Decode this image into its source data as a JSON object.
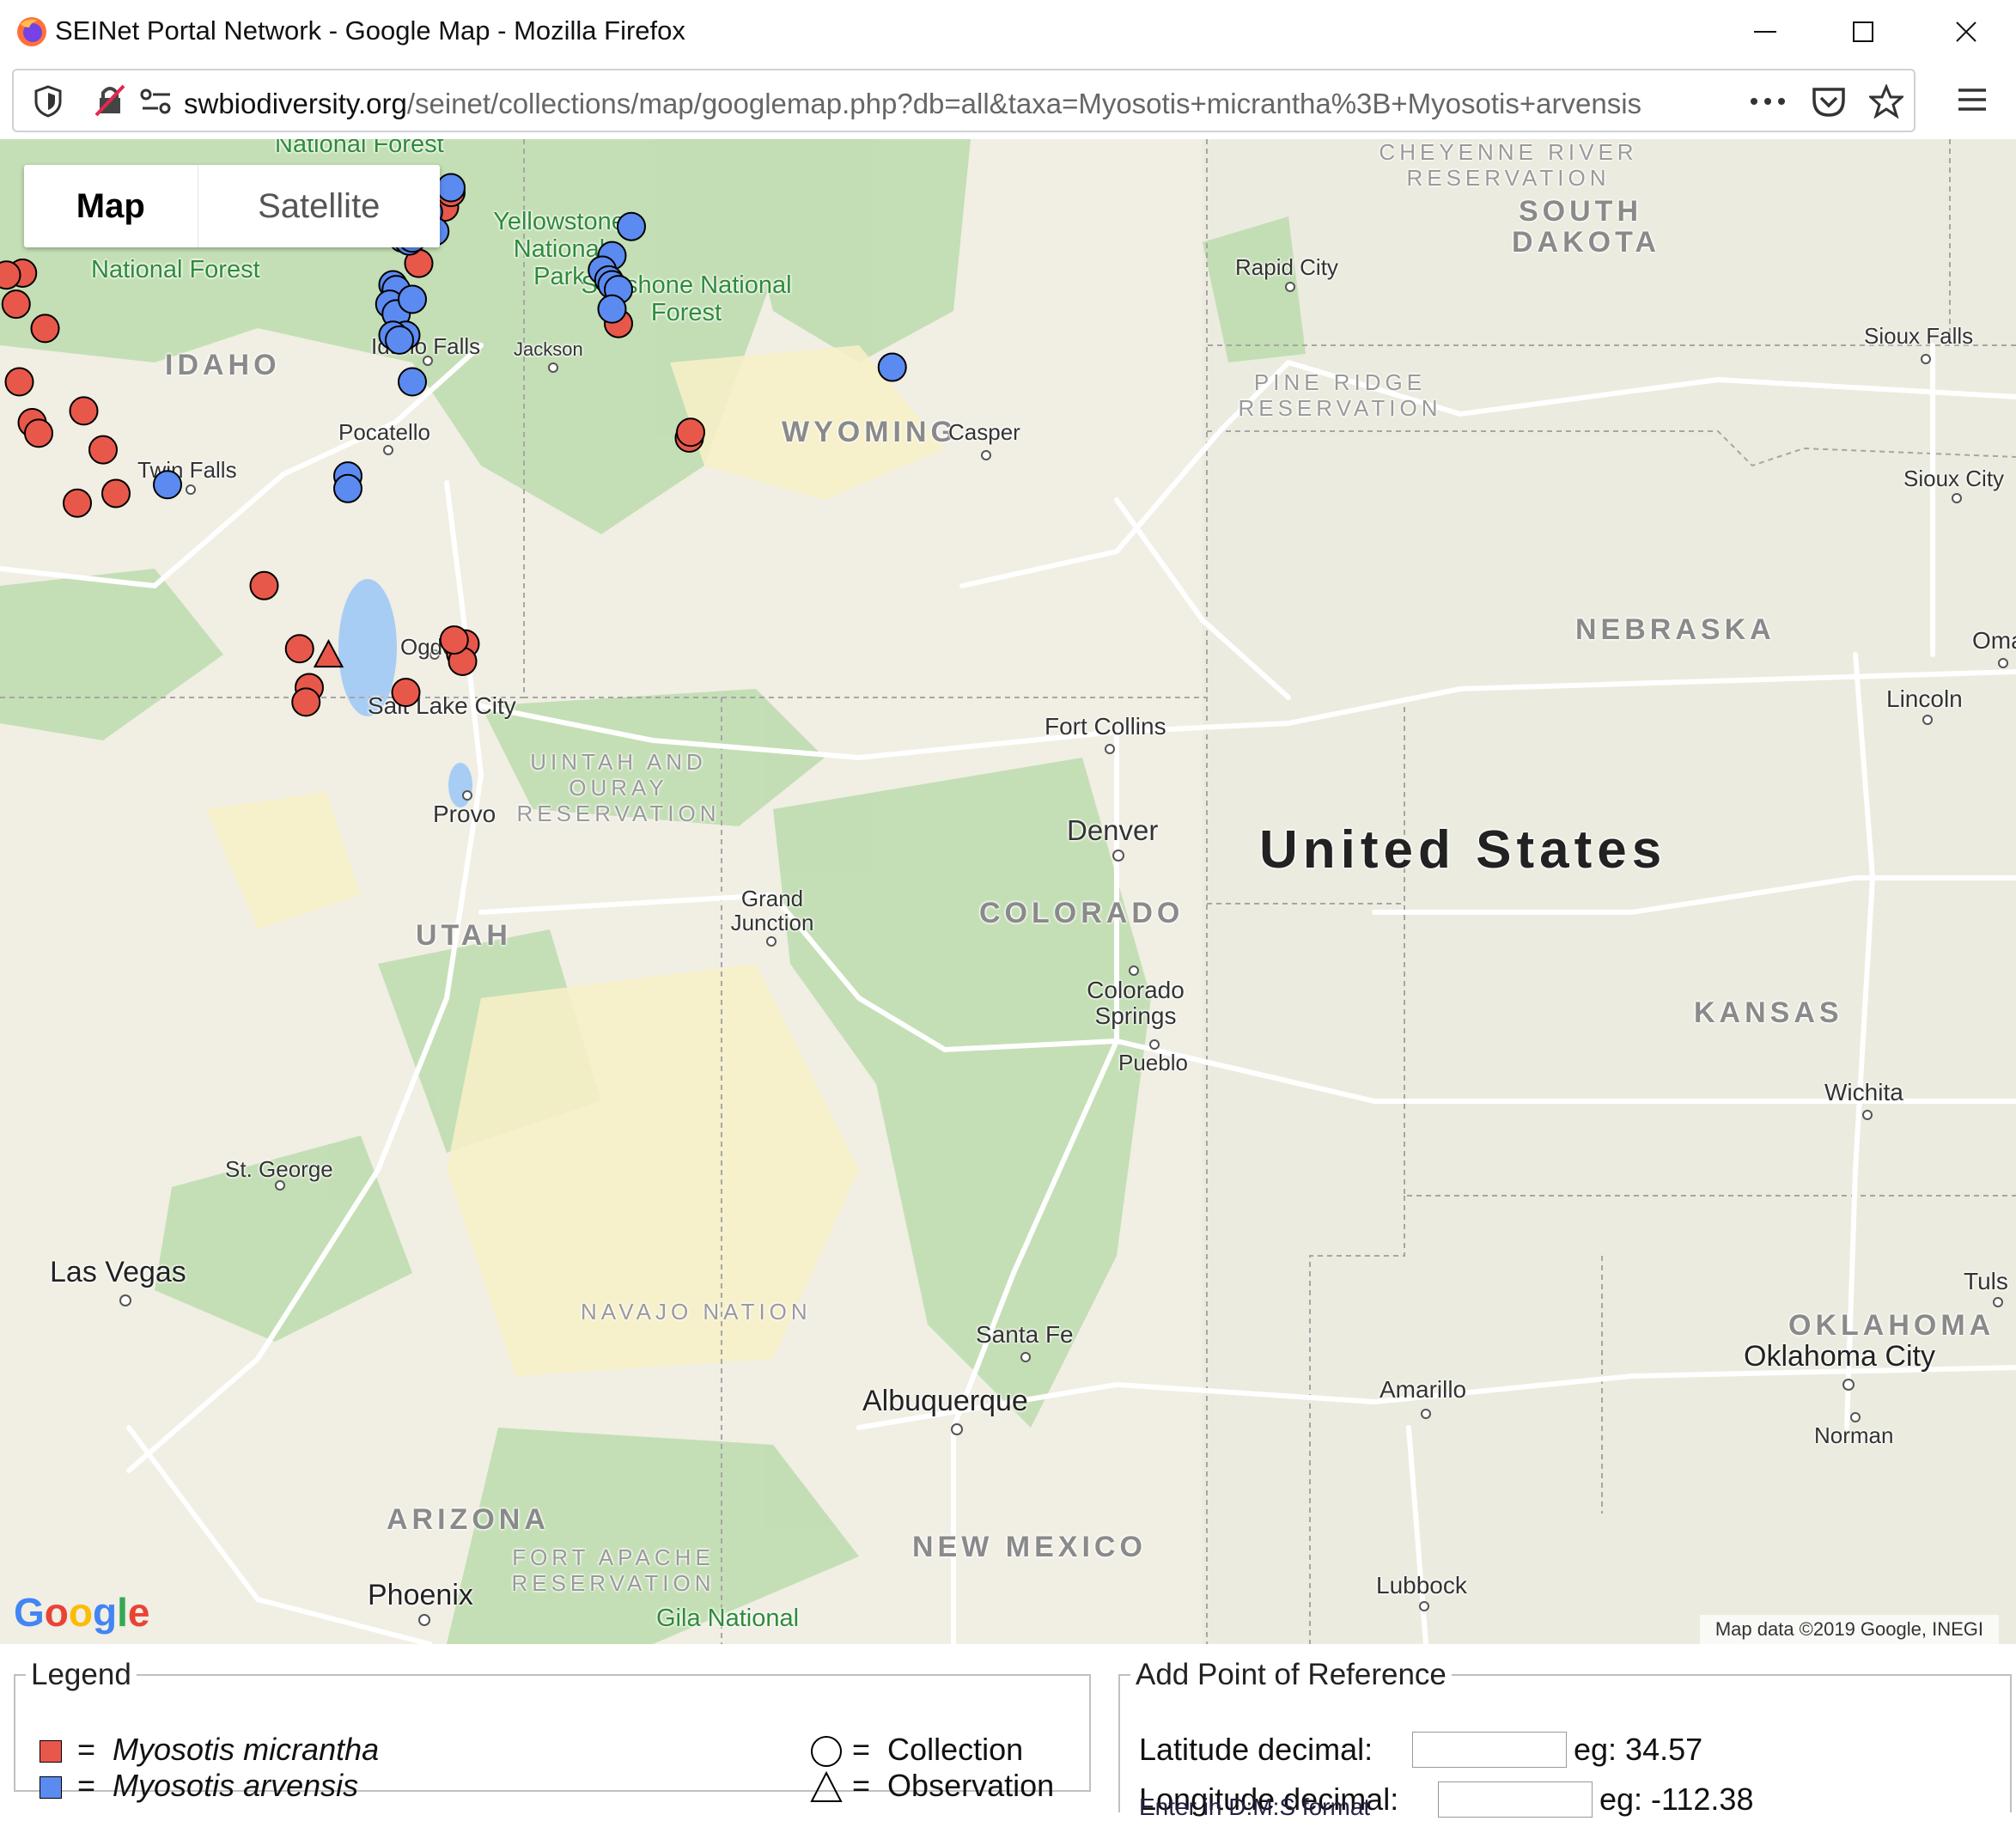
{
  "window": {
    "title": "SEINet Portal Network - Google Map - Mozilla Firefox"
  },
  "navbar": {
    "url_host": "swbiodiversity.org",
    "url_path": "/seinet/collections/map/googlemap.php?db=all&taxa=Myosotis+micrantha%3B+Myosotis+arvensis"
  },
  "map": {
    "type_buttons": {
      "map": "Map",
      "satellite": "Satellite"
    },
    "attribution": "Map data ©2019 Google, INEGI",
    "google_logo": "Google",
    "labels": {
      "country": "United States",
      "states": {
        "idaho": "IDAHO",
        "wyoming": "WYOMING",
        "south_dakota": "SOUTH DAKOTA",
        "nebraska": "NEBRASKA",
        "utah": "UTAH",
        "colorado": "COLORADO",
        "kansas": "KANSAS",
        "oklahoma": "OKLAHOMA",
        "arizona": "ARIZONA",
        "new_mexico": "NEW MEXICO"
      },
      "cities": {
        "rapid_city": "Rapid City",
        "sioux_falls": "Sioux Falls",
        "sioux_city": "Sioux City",
        "idaho_falls": "Idaho Falls",
        "jackson": "Jackson",
        "pocatello": "Pocatello",
        "casper": "Casper",
        "twin_falls": "Twin Falls",
        "ogden": "Ogden",
        "salt_lake_city": "Salt Lake City",
        "provo": "Provo",
        "fort_collins": "Fort Collins",
        "denver": "Denver",
        "lincoln": "Lincoln",
        "omaha": "Oma",
        "grand_junction": "Grand Junction",
        "colorado_springs": "Colorado Springs",
        "pueblo": "Pueblo",
        "wichita": "Wichita",
        "st_george": "St. George",
        "las_vegas": "Las Vegas",
        "santa_fe": "Santa Fe",
        "albuquerque": "Albuquerque",
        "amarillo": "Amarillo",
        "oklahoma_city": "Oklahoma City",
        "tulsa": "Tuls",
        "norman": "Norman",
        "lubbock": "Lubbock",
        "phoenix": "Phoenix"
      },
      "reservations": {
        "cheyenne_river": "CHEYENNE RIVER RESERVATION",
        "pine_ridge": "PINE RIDGE RESERVATION",
        "uintah_ouray": "UINTAH AND OURAY RESERVATION",
        "navajo": "NAVAJO NATION",
        "fort_apache": "FORT APACHE RESERVATION"
      },
      "parks": {
        "national_forest_top": "National Forest",
        "challis_nf": "National Forest",
        "yellowstone": "Yellowstone National Park",
        "shoshone": "Shoshone National Forest",
        "gila": "Gila National"
      }
    },
    "markers": {
      "micrantha_color": "#e8584a",
      "arvensis_color": "#5b8bf0",
      "micrantha": [
        [
          -116.25,
          44.62
        ],
        [
          -116.35,
          44.3
        ],
        [
          -115.9,
          44.05
        ],
        [
          -116.3,
          43.5
        ],
        [
          -116.1,
          43.08
        ],
        [
          -115.3,
          43.2
        ],
        [
          -116.0,
          42.97
        ],
        [
          -115.0,
          42.8
        ],
        [
          -115.4,
          42.25
        ],
        [
          -114.8,
          42.35
        ],
        [
          -112.5,
          41.4
        ],
        [
          -111.95,
          40.75
        ],
        [
          -111.8,
          40.35
        ],
        [
          -111.85,
          40.2
        ],
        [
          -110.3,
          40.3
        ],
        [
          -109.5,
          40.81
        ],
        [
          -109.45,
          40.7
        ],
        [
          -109.38,
          40.8
        ],
        [
          -109.42,
          40.62
        ],
        [
          -109.55,
          40.84
        ],
        [
          -110.8,
          45.3
        ],
        [
          -109.7,
          45.3
        ],
        [
          -109.6,
          45.45
        ],
        [
          -107.0,
          44.1
        ],
        [
          -105.9,
          42.92
        ],
        [
          -105.88,
          42.98
        ],
        [
          -116.5,
          44.6
        ],
        [
          -110.1,
          44.72
        ]
      ],
      "micrantha_observations": [
        [
          -111.5,
          40.68
        ]
      ],
      "arvensis": [
        [
          -110.35,
          44.98
        ],
        [
          -110.25,
          44.95
        ],
        [
          -110.2,
          44.98
        ],
        [
          -110.5,
          44.5
        ],
        [
          -110.45,
          44.45
        ],
        [
          -110.55,
          44.3
        ],
        [
          -110.45,
          44.2
        ],
        [
          -110.2,
          44.35
        ],
        [
          -110.3,
          43.98
        ],
        [
          -110.5,
          43.98
        ],
        [
          -110.4,
          43.93
        ],
        [
          -110.2,
          43.5
        ],
        [
          -109.95,
          45.25
        ],
        [
          -109.6,
          45.5
        ],
        [
          -109.85,
          45.05
        ],
        [
          -107.1,
          44.8
        ],
        [
          -107.25,
          44.65
        ],
        [
          -107.15,
          44.55
        ],
        [
          -107.1,
          44.5
        ],
        [
          -107.0,
          44.45
        ],
        [
          -107.1,
          44.25
        ],
        [
          -106.8,
          45.1
        ],
        [
          -102.75,
          43.65
        ],
        [
          -111.2,
          42.53
        ],
        [
          -111.2,
          42.4
        ],
        [
          -114.0,
          42.44
        ]
      ]
    }
  },
  "legend_panel": {
    "title": "Legend",
    "micrantha_label": "Myosotis micrantha",
    "arvensis_label": "Myosotis arvensis",
    "eq": "=",
    "collection_label": "Collection",
    "observation_label": "Observation",
    "micrantha_color": "#e8584a",
    "arvensis_color": "#5b8bf0"
  },
  "reference_panel": {
    "title": "Add Point of Reference",
    "lat_label": "Latitude decimal:",
    "lat_example": "eg: 34.57",
    "lat_value": "",
    "lon_label": "Longitude decimal:",
    "lon_example": "eg: -112.38",
    "lon_value": "",
    "dms_link": "Enter in D:M:S format"
  }
}
